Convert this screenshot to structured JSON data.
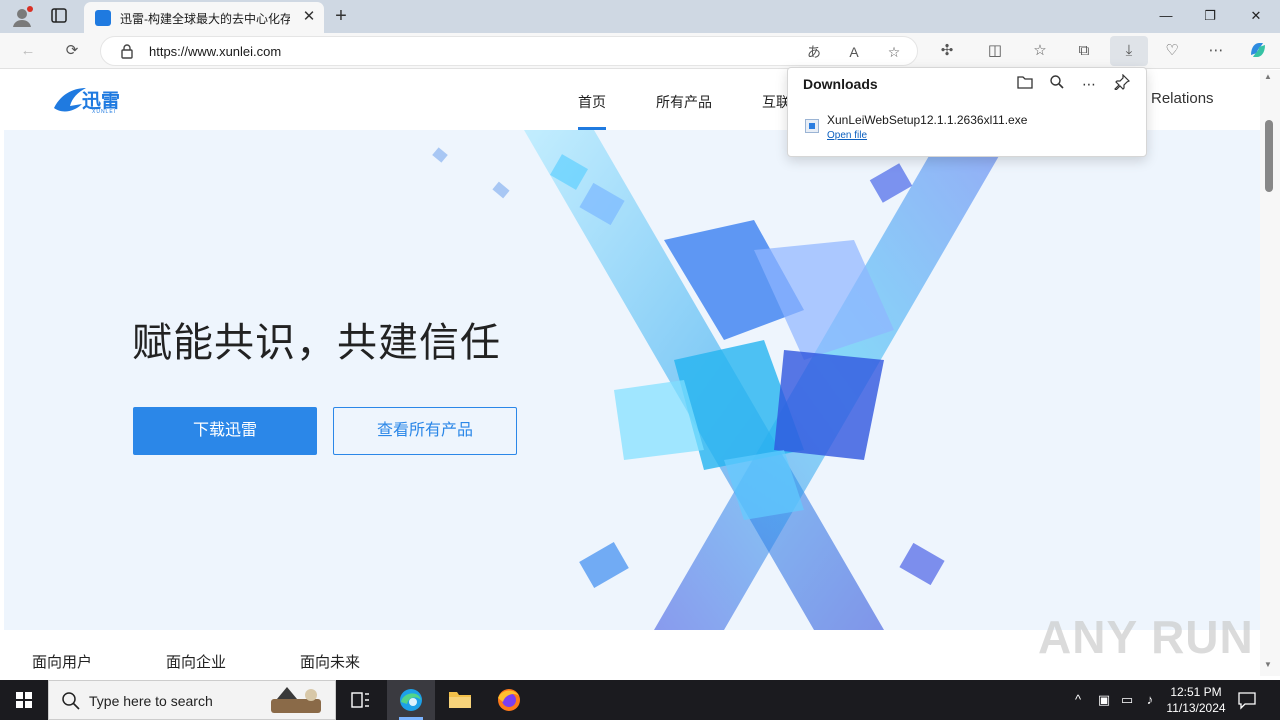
{
  "browser": {
    "tab_title": "迅雷-构建全球最大的去中心化存",
    "tab_close": "✕",
    "new_tab": "+",
    "url": "https://www.xunlei.com",
    "window_controls": {
      "minimize": "—",
      "maximize": "❐",
      "close": "✕"
    }
  },
  "site": {
    "logo_text": "迅雷",
    "logo_sub": "XUNLEI",
    "nav": [
      "首页",
      "所有产品",
      "互联"
    ],
    "nav_relations": "Relations",
    "hero_title": "赋能共识，共建信任",
    "primary_button": "下载迅雷",
    "secondary_button": "查看所有产品",
    "bottom_tabs": [
      "面向用户",
      "面向企业",
      "面向未来"
    ],
    "watermark": "ANY RUN"
  },
  "downloads": {
    "title": "Downloads",
    "filename": "XunLeiWebSetup12.1.1.2636xl11.exe",
    "open_file": "Open file"
  },
  "taskbar": {
    "search_placeholder": "Type here to search",
    "time": "12:51 PM",
    "date": "11/13/2024"
  },
  "colors": {
    "accent": "#2b87e8",
    "tabstrip": "#cfd8e3",
    "taskbar": "#1b1b1f"
  }
}
